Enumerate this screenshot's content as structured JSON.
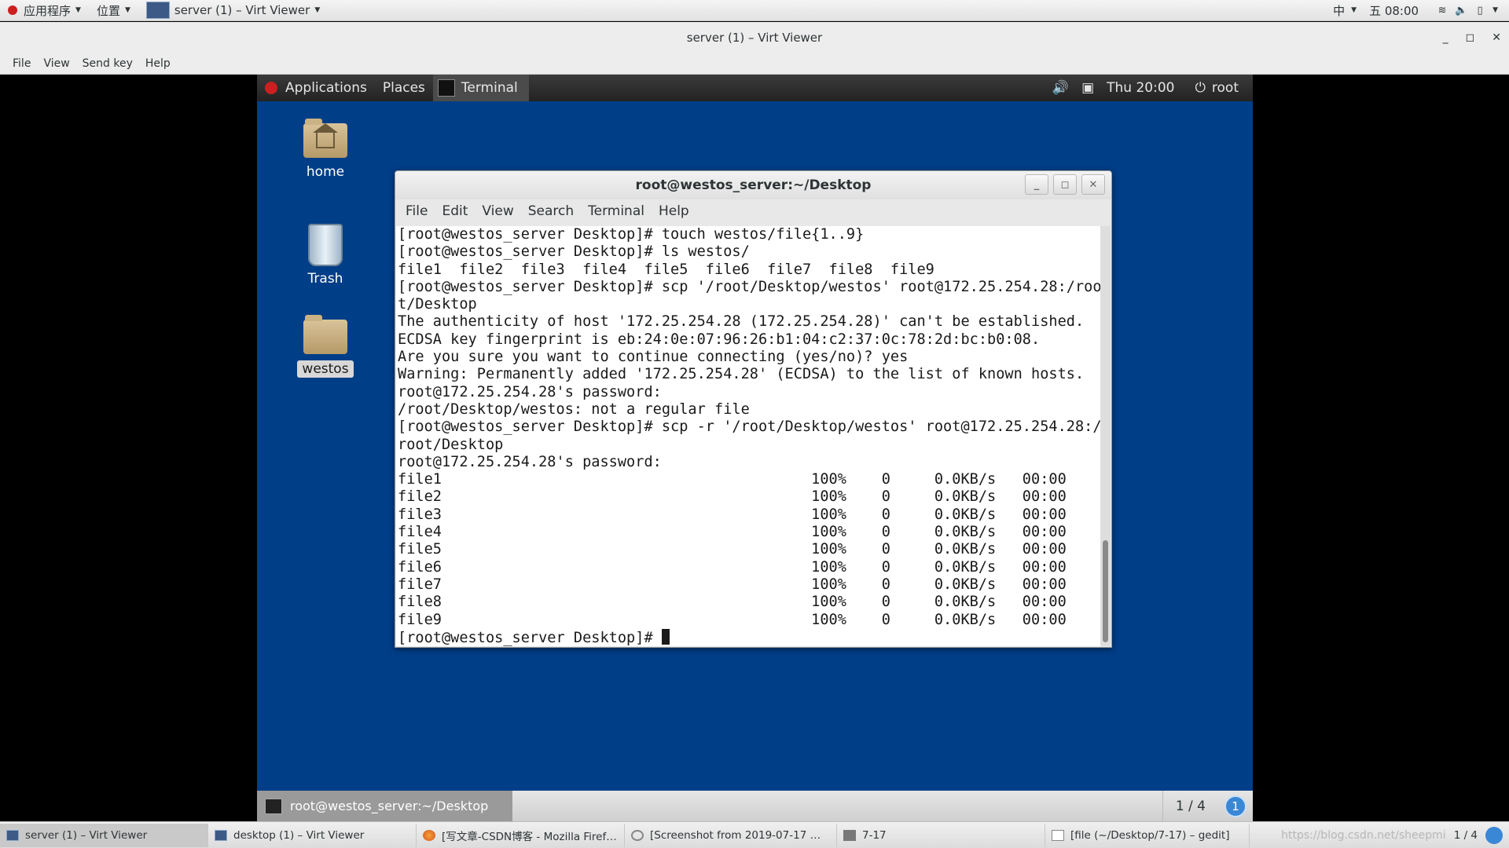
{
  "host_panel": {
    "applications": "应用程序",
    "places": "位置",
    "window": "server (1) – Virt Viewer",
    "input_method": "中",
    "clock": "五 08:00"
  },
  "viewer": {
    "title": "server (1) – Virt Viewer",
    "menu": [
      "File",
      "View",
      "Send key",
      "Help"
    ]
  },
  "guest_panel": {
    "applications": "Applications",
    "places": "Places",
    "active_app": "Terminal",
    "clock": "Thu 20:00",
    "user": "root"
  },
  "desktop_icons": {
    "home": "home",
    "trash": "Trash",
    "westos": "westos"
  },
  "terminal": {
    "title": "root@westos_server:~/Desktop",
    "menu": [
      "File",
      "Edit",
      "View",
      "Search",
      "Terminal",
      "Help"
    ],
    "lines": [
      "[root@westos_server Desktop]# touch westos/file{1..9}",
      "[root@westos_server Desktop]# ls westos/",
      "file1  file2  file3  file4  file5  file6  file7  file8  file9",
      "[root@westos_server Desktop]# scp '/root/Desktop/westos' root@172.25.254.28:/roo",
      "t/Desktop",
      "The authenticity of host '172.25.254.28 (172.25.254.28)' can't be established.",
      "ECDSA key fingerprint is eb:24:0e:07:96:26:b1:04:c2:37:0c:78:2d:bc:b0:08.",
      "Are you sure you want to continue connecting (yes/no)? yes",
      "Warning: Permanently added '172.25.254.28' (ECDSA) to the list of known hosts.",
      "root@172.25.254.28's password: ",
      "/root/Desktop/westos: not a regular file",
      "[root@westos_server Desktop]# scp -r '/root/Desktop/westos' root@172.25.254.28:/",
      "root/Desktop",
      "root@172.25.254.28's password: ",
      "file1                                          100%    0     0.0KB/s   00:00",
      "file2                                          100%    0     0.0KB/s   00:00",
      "file3                                          100%    0     0.0KB/s   00:00",
      "file4                                          100%    0     0.0KB/s   00:00",
      "file5                                          100%    0     0.0KB/s   00:00",
      "file6                                          100%    0     0.0KB/s   00:00",
      "file7                                          100%    0     0.0KB/s   00:00",
      "file8                                          100%    0     0.0KB/s   00:00",
      "file9                                          100%    0     0.0KB/s   00:00"
    ],
    "prompt": "[root@westos_server Desktop]# "
  },
  "guest_bottom": {
    "task": "root@westos_server:~/Desktop",
    "workspace": "1 / 4",
    "notification_count": "1"
  },
  "host_taskbar": {
    "items": [
      "server (1) – Virt Viewer",
      "desktop (1) – Virt Viewer",
      "[写文章-CSDN博客 - Mozilla Firef…",
      "[Screenshot from 2019-07-17 …",
      "7-17",
      "[file (~/Desktop/7-17) – gedit]"
    ],
    "watermark": "https://blog.csdn.net/sheepmi",
    "workspace": "1 / 4"
  }
}
